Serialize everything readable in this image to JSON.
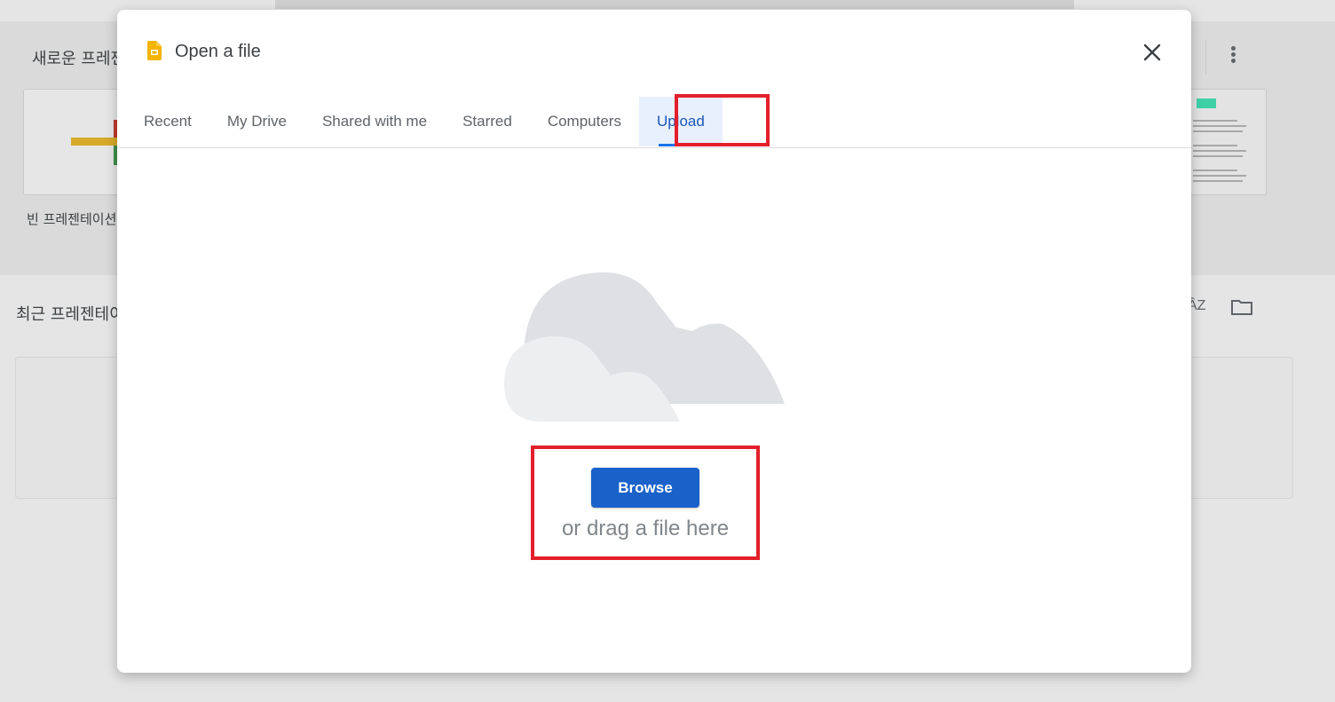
{
  "background": {
    "new_presentation_title": "새로운 프레젠",
    "blank_label": "빈 프레젠테이션",
    "recent_title": "최근 프레젠테이",
    "sort_icon_text": "ÂZ"
  },
  "dialog": {
    "title": "Open a file",
    "tabs": [
      {
        "label": "Recent"
      },
      {
        "label": "My Drive"
      },
      {
        "label": "Shared with me"
      },
      {
        "label": "Starred"
      },
      {
        "label": "Computers"
      },
      {
        "label": "Upload",
        "active": true
      }
    ],
    "browse_label": "Browse",
    "drag_text": "or drag a file here"
  },
  "colors": {
    "accent": "#1a73e8",
    "browse_button": "#1a62c9",
    "highlight": "#e3202a",
    "slides_yellow": "#f4b400"
  },
  "icons": [
    "slides-icon",
    "close-icon",
    "cloud-icon",
    "more-vert-icon",
    "folder-icon",
    "sort-icon"
  ]
}
